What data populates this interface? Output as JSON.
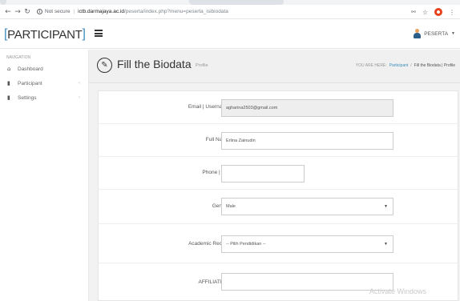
{
  "browser": {
    "back_icon": "back-arrow-icon",
    "forward_icon": "forward-arrow-icon",
    "reload_icon": "reload-icon",
    "security_label": "Not secure",
    "url_host": "ictb.darmajaya.ac.id",
    "url_path": "/peserta/index.php?menu=peserta_isibiodata"
  },
  "header": {
    "brand_bracket_open": "[",
    "brand_text": "PARTICIPANT",
    "brand_bracket_close": "]",
    "user_label": "PESERTA"
  },
  "sidebar": {
    "heading": "NAVIGATION",
    "items": [
      {
        "label": "Dashboard",
        "icon": "home-icon",
        "has_arrow": false
      },
      {
        "label": "Participant",
        "icon": "file-icon",
        "has_arrow": true
      },
      {
        "label": "Settings",
        "icon": "file-icon",
        "has_arrow": true
      }
    ]
  },
  "page": {
    "title": "Fill the Biodata",
    "subtitle": "Profile",
    "breadcrumb_prefix": "YOU ARE HERE:",
    "breadcrumb_link": "Participant",
    "breadcrumb_sep": "/",
    "breadcrumb_current": "Fill the Biodata | Profile"
  },
  "form": {
    "email_label": "Email | Username :",
    "email_value": "agharina2503@gmail.com",
    "fullname_label": "Full Name :",
    "fullname_value": "Erlina Zainudin",
    "phone_label": "Phone | WA :",
    "phone_value": "",
    "gender_label": "Gender :",
    "gender_value": "Male",
    "academic_label": "Academic Record :",
    "academic_value": "-- Pilih Pendidikan --",
    "affiliation_label": "AFFILIATION :",
    "affiliation_value": ""
  },
  "watermark": "Activate Windows",
  "colors": {
    "accent": "#3c8dbc",
    "content_bg": "#f2f2f2"
  }
}
